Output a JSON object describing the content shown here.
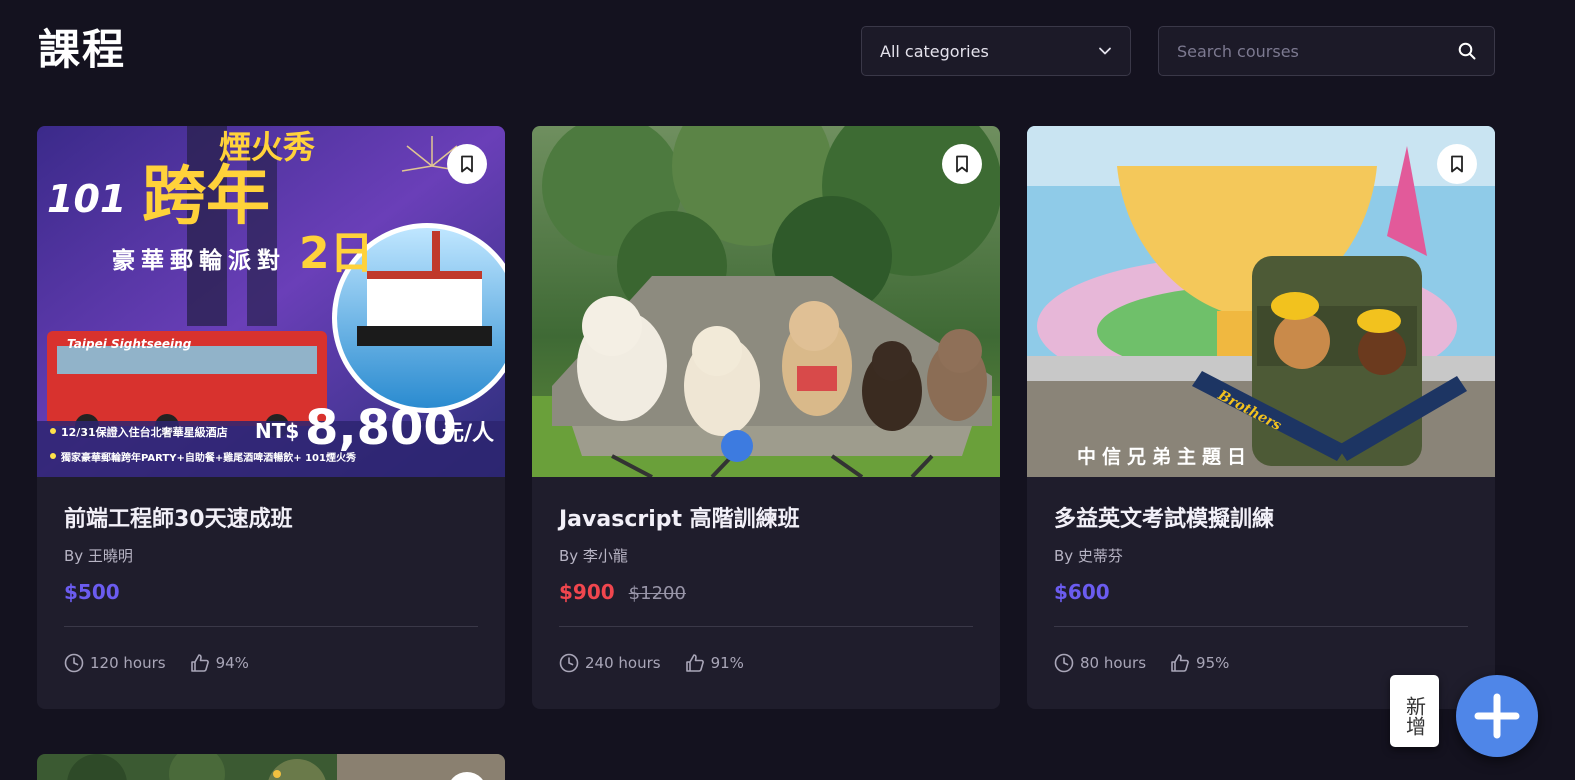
{
  "header": {
    "title": "課程",
    "category_select": "All categories",
    "search_placeholder": "Search courses"
  },
  "courses": [
    {
      "title": "前端工程師30天速成班",
      "author": "By 王曉明",
      "price": "$500",
      "old_price": "",
      "hours": "120 hours",
      "rating": "94%",
      "image_texts": {
        "headline": "跨年",
        "subtitle": "豪華郵輪派對",
        "days": "2日",
        "fireworks": "煙火秀",
        "number": "101",
        "bus": "Taipei Sightseeing",
        "price_label": "NT$",
        "price_value": "8,800",
        "price_unit": "元/人",
        "bullet1": "12/31保證入住台北奢華星級酒店",
        "bullet2": "獨家豪華郵輪跨年PARTY+自助餐+雞尾酒啤酒暢飲+ 101煙火秀"
      }
    },
    {
      "title": "Javascript 高階訓練班",
      "author": "By 李小龍",
      "price": "$900",
      "old_price": "$1200",
      "hours": "240 hours",
      "rating": "91%"
    },
    {
      "title": "多益英文考試模擬訓練",
      "author": "By 史蒂芬",
      "price": "$600",
      "old_price": "",
      "hours": "80 hours",
      "rating": "95%",
      "image_texts": {
        "caption": "中信兄弟主題日",
        "bat": "Brothers"
      }
    }
  ],
  "fab": {
    "label": "新增"
  },
  "colors": {
    "background": "#14121f",
    "card": "#1f1d2c",
    "price": "#6b5cf0",
    "sale_price": "#f0464e",
    "fab": "#4f86e8"
  }
}
